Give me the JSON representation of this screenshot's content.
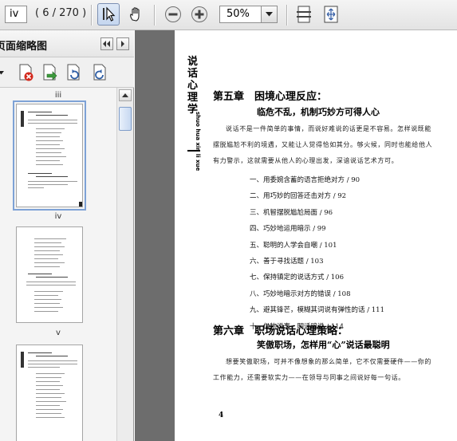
{
  "toolbar": {
    "page_value": "iv",
    "page_count": "( 6 / 270 )",
    "zoom_value": "50%"
  },
  "panel": {
    "title": "页面缩略图",
    "thumbnails": [
      {
        "label": "iii"
      },
      {
        "label": "iv"
      },
      {
        "label": "v"
      }
    ]
  },
  "page": {
    "side_title": "说话心理学",
    "side_en": "shuo hua xin li xue",
    "chapter5_title": "第五章　困境心理反应：",
    "chapter5_subtitle": "临危不乱，机制巧妙方可得人心",
    "chapter5_intro": "说话不是一件简单的事情，而说好难说的话更是不容易。怎样说既能摆脱尴尬不利的境遇，又能让人觉得恰如其分。够火候，同时也能给他人有力警示，这就需要从他人的心理出发，深谙说话艺术方可。",
    "chapter5_items": [
      "一、用委婉含蓄的语言拒绝对方 / 90",
      "二、用巧妙的回答还击对方 / 92",
      "三、机智摆脱尴尬局面 / 96",
      "四、巧妙地运用暗示 / 99",
      "五、聪明的人学会自嘲 / 101",
      "六、善于寻找话题 / 103",
      "七、保持镇定的说话方式 / 106",
      "八、巧妙地暗示对方的错误 / 108",
      "九、避其锋芒，模糊其词说有弹性的话 / 111",
      "十、借物说事，明话暗说 / 114"
    ],
    "chapter6_title": "第六章　职场说话心理策略：",
    "chapter6_subtitle": "笑傲职场，怎样用“心”说话最聪明",
    "chapter6_intro": "想要笑傲职场，可并不像想象的那么简单，它不仅需要硬件——你的工作能力，还需要软实力——在领导与同事之间说好每一句话。",
    "page_number": "4"
  },
  "colors": {
    "viewer_bg": "#6d6d6d",
    "selection": "#7ea2d6"
  }
}
